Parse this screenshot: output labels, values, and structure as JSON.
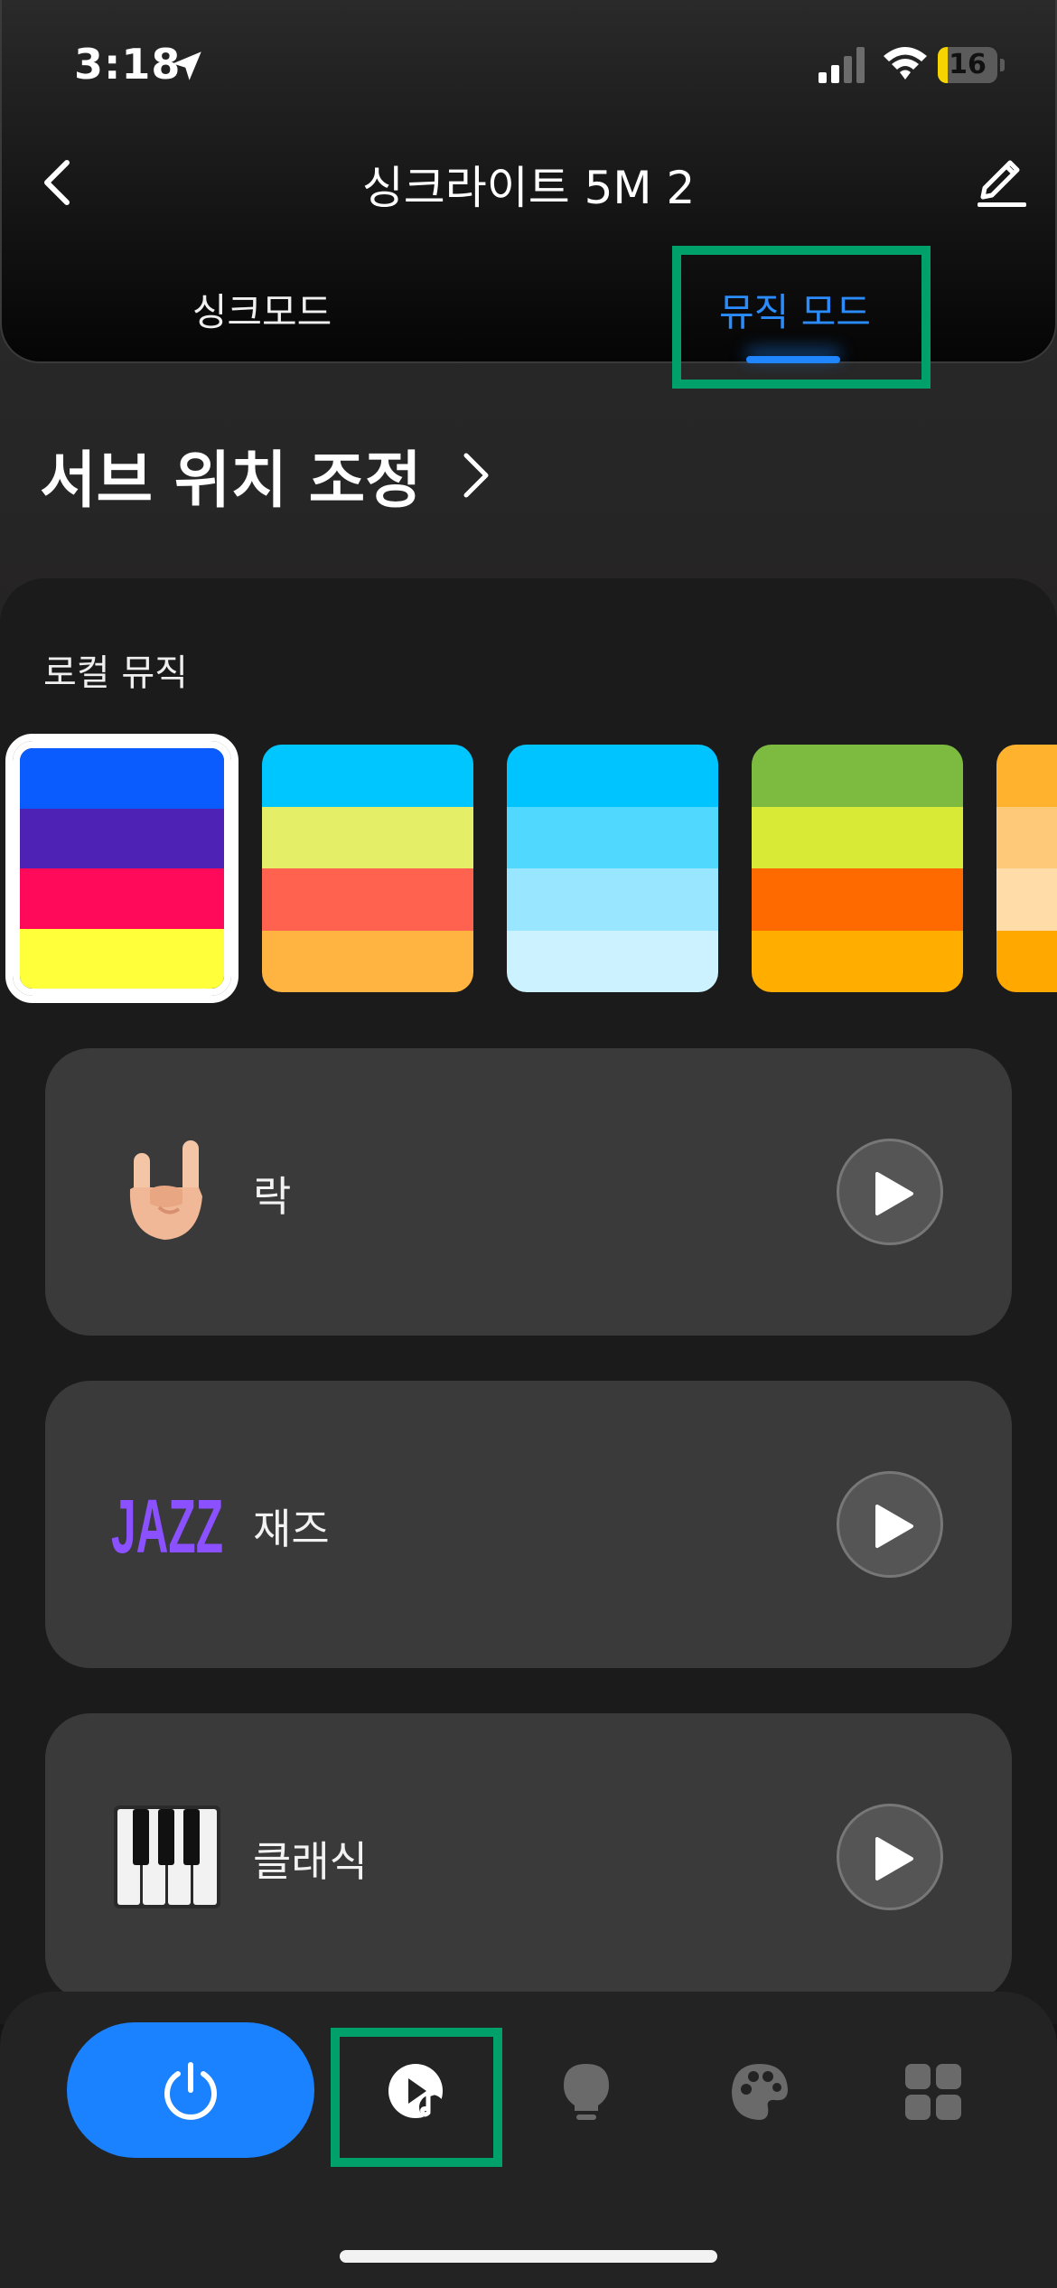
{
  "status_bar": {
    "time": "3:18",
    "battery_level": "16",
    "battery_fraction": 0.16
  },
  "header": {
    "title": "싱크라이트 5M 2",
    "tabs": [
      {
        "label": "싱크모드",
        "active": false
      },
      {
        "label": "뮤직 모드",
        "active": true
      }
    ],
    "accent_color": "#1a82ff"
  },
  "sub_position": {
    "label": "서브 위치 조정"
  },
  "local_music": {
    "label": "로컬 뮤직",
    "palettes": [
      {
        "selected": true,
        "colors": [
          "#0a5cff",
          "#4e22b4",
          "#ff0a5a",
          "#ffff3a"
        ]
      },
      {
        "selected": false,
        "colors": [
          "#00c6ff",
          "#e4ee66",
          "#ff6350",
          "#ffb340"
        ]
      },
      {
        "selected": false,
        "colors": [
          "#00c4ff",
          "#50d8ff",
          "#98e6ff",
          "#ccf2ff"
        ]
      },
      {
        "selected": false,
        "colors": [
          "#7cbb40",
          "#d8ea36",
          "#ff6a00",
          "#ffae00"
        ]
      },
      {
        "selected": false,
        "colors": [
          "#ffb22e",
          "#ffc97a",
          "#ffdca8",
          "#ffa800"
        ]
      }
    ]
  },
  "music_items": [
    {
      "label": "락",
      "icon": "rock-hand-icon"
    },
    {
      "label": "재즈",
      "icon": "jazz-icon",
      "icon_text": "JAZZ"
    },
    {
      "label": "클래식",
      "icon": "piano-keys-icon"
    }
  ],
  "bottom_nav": {
    "items": [
      "power-icon",
      "music-mode-icon",
      "bulb-icon",
      "palette-icon",
      "grid-icon"
    ]
  },
  "highlight_color": "#00a06a"
}
